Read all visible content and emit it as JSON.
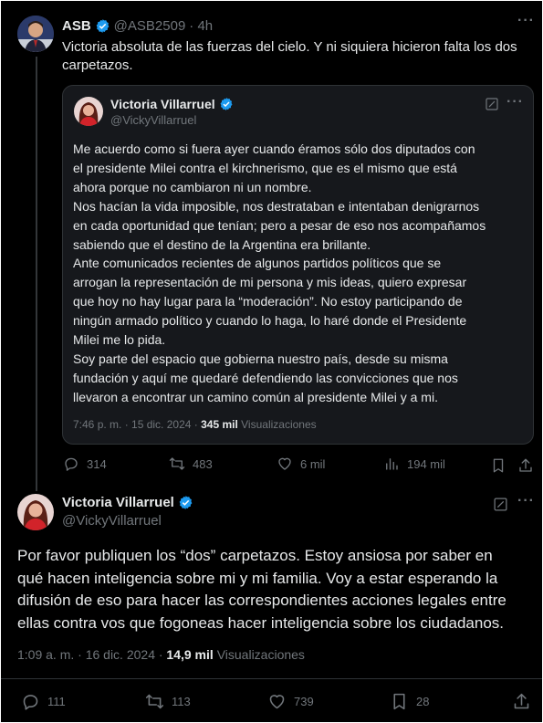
{
  "tweet": {
    "author_name": "ASB",
    "author_handle": "@ASB2509",
    "time": "· 4h",
    "text_line1": "Victoria absoluta de las fuerzas del cielo. Y ni siquiera hicieron falta los dos",
    "text_line2": "carpetazos.",
    "actions": {
      "replies": "314",
      "retweets": "483",
      "likes": "6 mil",
      "views": "194 mil"
    }
  },
  "quote": {
    "author_name": "Victoria Villarruel",
    "author_handle": "@VickyVillarruel",
    "lines": [
      "Me acuerdo como si fuera ayer cuando éramos sólo dos diputados con",
      "el presidente Milei contra el kirchnerismo, que es el mismo que está",
      "ahora porque no cambiaron ni un nombre.",
      "Nos hacían la vida imposible, nos destrataban e intentaban denigrarnos",
      "en cada oportunidad que tenían; pero a pesar de eso nos acompañamos",
      "sabiendo que el destino de la Argentina era brillante.",
      "Ante comunicados recientes de algunos partidos políticos que se",
      "arrogan la representación de mi persona y mis ideas, quiero expresar",
      "que hoy no hay lugar para la “moderación”.  No estoy participando de",
      "ningún armado político y cuando lo haga, lo haré donde el Presidente",
      "Milei me lo pida.",
      "Soy parte del espacio que gobierna nuestro país, desde su misma",
      "fundación y aquí me quedaré defendiendo las convicciones que nos",
      "llevaron a encontrar un camino común al presidente Milei y a mi."
    ],
    "timestamp": "7:46 p. m. · 15 dic. 2024 ·",
    "views_count": "345 mil",
    "views_label": "Visualizaciones"
  },
  "reply": {
    "author_name": "Victoria Villarruel",
    "author_handle": "@VickyVillarruel",
    "lines": [
      "Por favor publiquen los “dos” carpetazos. Estoy ansiosa por saber en",
      "qué hacen inteligencia sobre mi y mi familia. Voy a estar esperando la",
      "difusión de eso para hacer las correspondientes acciones legales entre",
      "ellas contra vos que fogoneas hacer inteligencia sobre los ciudadanos."
    ],
    "timestamp": "1:09 a. m. · 16 dic. 2024 ·",
    "views_count": "14,9 mil",
    "views_label": "Visualizaciones",
    "actions": {
      "replies": "111",
      "retweets": "113",
      "likes": "739",
      "bookmarks": "28"
    }
  },
  "colors": {
    "background": "#000000",
    "text": "#e7e9ea",
    "muted": "#71767b",
    "verified": "#1d9bf0",
    "border": "#2f3336"
  },
  "icons": [
    "verified-badge-icon",
    "more-icon",
    "grok-icon",
    "reply-icon",
    "retweet-icon",
    "like-icon",
    "views-icon",
    "bookmark-icon",
    "share-icon"
  ]
}
